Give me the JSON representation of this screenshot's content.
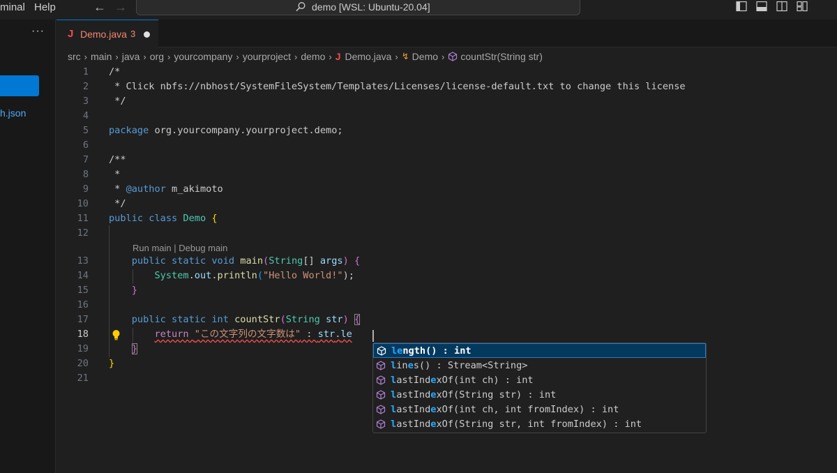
{
  "menu": {
    "terminal": "minal",
    "help": "Help"
  },
  "command_center": {
    "label": "demo [WSL: Ubuntu-20.04]"
  },
  "sidebar": {
    "more": "···",
    "file": "h.json"
  },
  "tab": {
    "icon": "J",
    "name": "Demo.java",
    "problems": "3"
  },
  "breadcrumb": {
    "items": [
      "src",
      "main",
      "java",
      "org",
      "yourcompany",
      "yourproject",
      "demo"
    ],
    "file_icon": "J",
    "file": "Demo.java",
    "class": "Demo",
    "method": "countStr(String str)"
  },
  "editor": {
    "line_numbers": [
      "1",
      "2",
      "3",
      "4",
      "5",
      "6",
      "7",
      "8",
      "9",
      "10",
      "11",
      "12",
      "13",
      "14",
      "15",
      "16",
      "17",
      "18",
      "19",
      "20",
      "21"
    ],
    "lines": {
      "l1": "/*",
      "l2": " * Click nbfs://nbhost/SystemFileSystem/Templates/Licenses/license-default.txt to change this license",
      "l3": " */",
      "l5_kw": "package",
      "l5_rest": " org.yourcompany.yourproject.demo;",
      "l7": "/**",
      "l8": " *",
      "l9_a": " * ",
      "l9_tag": "@author",
      "l9_b": " m_akimoto",
      "l10": " */",
      "l11_kw": "public class",
      "l11_name": "Demo",
      "l11_brace": "{",
      "l13_kw": "public static void",
      "l13_fn": "main",
      "l13_p1": "(",
      "l13_ty": "String",
      "l13_arr": "[]",
      "l13_var": "args",
      "l13_p2": ")",
      "l13_brace": "{",
      "l14_obj": "System",
      "l14_dot1": ".",
      "l14_out": "out",
      "l14_dot2": ".",
      "l14_fn": "println",
      "l14_p1": "(",
      "l14_str": "\"Hello World!\"",
      "l14_p2": ");",
      "l15": "}",
      "l17_kw": "public static int",
      "l17_fn": "countStr",
      "l17_p1": "(",
      "l17_ty": "String",
      "l17_var": "str",
      "l17_p2": ")",
      "l17_brace": "{",
      "l18_kw": "return",
      "l18_str": "\"この文字列の文字数は\"",
      "l18_plus": " : ",
      "l18_var": "str",
      "l18_dot": ".",
      "l18_typed": "le",
      "l19": "}",
      "l20": "}"
    },
    "codelens": "Run main | Debug main"
  },
  "suggestions": [
    {
      "pre": "",
      "hl1": "le",
      "mid": "ngth() : int",
      "hl2": "",
      "post": ""
    },
    {
      "pre": "",
      "hl1": "l",
      "mid": "in",
      "hl2": "e",
      "post": "s() : Stream<String>"
    },
    {
      "pre": "",
      "hl1": "l",
      "mid": "astInd",
      "hl2": "e",
      "post": "xOf(int ch) : int"
    },
    {
      "pre": "",
      "hl1": "l",
      "mid": "astInd",
      "hl2": "e",
      "post": "xOf(String str) : int"
    },
    {
      "pre": "",
      "hl1": "l",
      "mid": "astInd",
      "hl2": "e",
      "post": "xOf(int ch, int fromIndex) : int"
    },
    {
      "pre": "",
      "hl1": "l",
      "mid": "astInd",
      "hl2": "e",
      "post": "xOf(String str, int fromIndex) : int"
    }
  ],
  "icons": {
    "search": "search-icon",
    "back": "arrow-left-icon",
    "forward": "arrow-right-icon",
    "method": "method-cube-icon",
    "class": "class-icon",
    "lightbulb": "lightbulb-icon"
  },
  "colors": {
    "accent": "#0078d4",
    "error": "#f14c4c",
    "selection": "#04395e",
    "match": "#2aaaff"
  }
}
